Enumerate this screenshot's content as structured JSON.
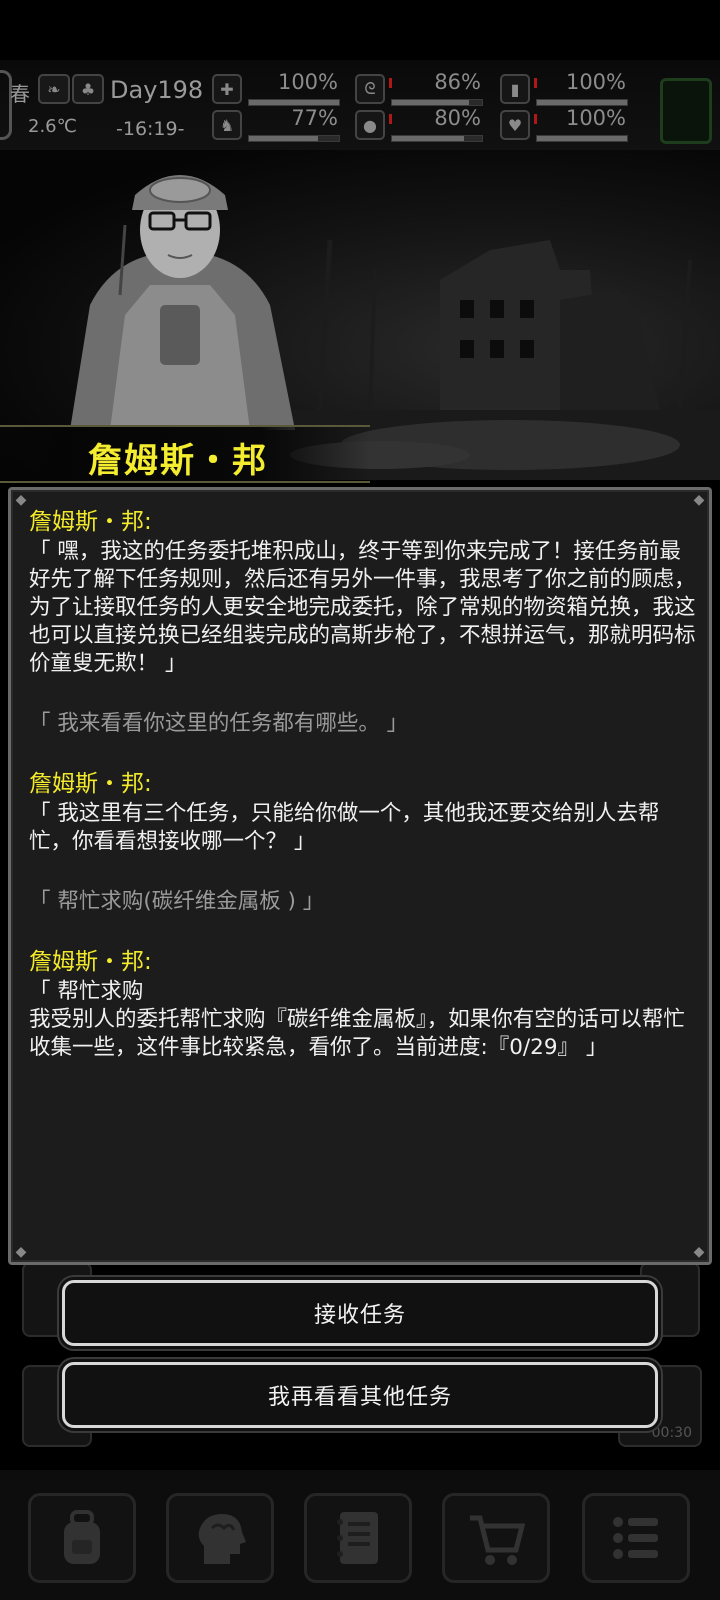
{
  "hud": {
    "season": "春",
    "temperature": "2.6℃",
    "day": "Day198",
    "time": "-16:19-",
    "stats": [
      {
        "icon": "medkit-icon",
        "value": "100%",
        "level": 1.0
      },
      {
        "icon": "stomach-icon",
        "value": "86%",
        "level": 0.86
      },
      {
        "icon": "battery-icon",
        "value": "100%",
        "level": 1.0
      },
      {
        "icon": "leg-icon",
        "value": "77%",
        "level": 0.77
      },
      {
        "icon": "water-drop-icon",
        "value": "80%",
        "level": 0.8
      },
      {
        "icon": "heart-icon",
        "value": "100%",
        "level": 1.0
      }
    ]
  },
  "npc": {
    "name": "詹姆斯・邦"
  },
  "dialog": {
    "speaker_label": "詹姆斯・邦:",
    "line1": "「 嘿，我这的任务委托堆积成山，终于等到你来完成了！接任务前最好先了解下任务规则，然后还有另外一件事，我思考了你之前的顾虑，为了让接取任务的人更安全地完成委托，除了常规的物资箱兑换，我这也可以直接兑换已经组装完成的高斯步枪了，不想拼运气，那就明码标价童叟无欺！ 」",
    "choice1": "「 我来看看你这里的任务都有哪些。 」",
    "line2": "「 我这里有三个任务，只能给你做一个，其他我还要交给别人去帮忙，你看看想接收哪一个？ 」",
    "choice2": "「 帮忙求购(碳纤维金属板 ) 」",
    "line3": "「 帮忙求购\n我受别人的委托帮忙求购『碳纤维金属板』，如果你有空的话可以帮忙收集一些，这件事比较紧急，看你了。当前进度:『0/29』 」"
  },
  "actions": {
    "accept_label": "接收任务",
    "other_label": "我再看看其他任务"
  },
  "background_ui": {
    "timer": "00:30"
  },
  "bottom_nav": [
    {
      "icon": "backpack-icon"
    },
    {
      "icon": "brain-icon"
    },
    {
      "icon": "notebook-icon"
    },
    {
      "icon": "cart-icon"
    },
    {
      "icon": "menu-icon"
    }
  ]
}
